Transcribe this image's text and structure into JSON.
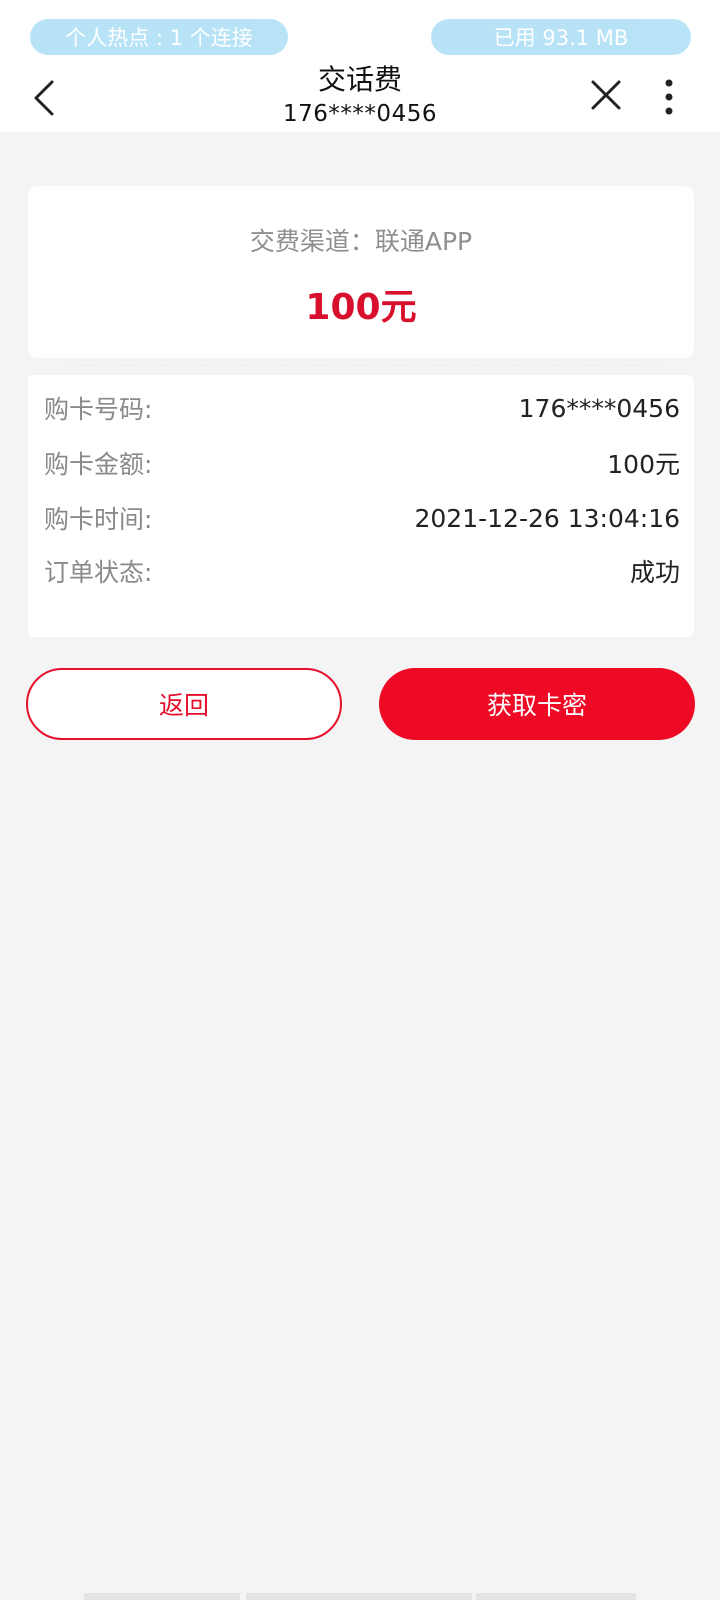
{
  "status_bar": {
    "hotspot": "个人热点 : 1 个连接",
    "data_used": "已用 93.1 MB"
  },
  "header": {
    "title": "交话费",
    "subtitle": "176****0456",
    "back_icon": "chevron-left-icon",
    "close_icon": "close-icon",
    "more_icon": "more-vertical-icon"
  },
  "summary": {
    "channel": "交费渠道：联通APP",
    "amount": "100元"
  },
  "details": [
    {
      "label": "购卡号码:",
      "value": "176****0456"
    },
    {
      "label": "购卡金额:",
      "value": "100元"
    },
    {
      "label": "购卡时间:",
      "value": "2021-12-26 13:04:16"
    },
    {
      "label": "订单状态:",
      "value": "成功"
    }
  ],
  "actions": {
    "back_label": "返回",
    "get_pin_label": "获取卡密"
  },
  "colors": {
    "accent": "#ee0a24",
    "amount": "#d8102e",
    "background": "#f5f4f4"
  }
}
